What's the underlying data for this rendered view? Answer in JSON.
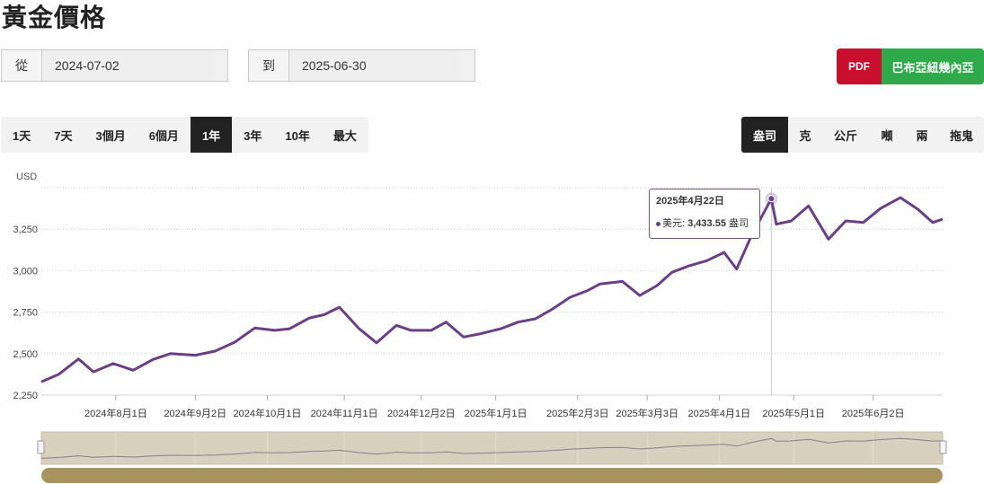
{
  "page": {
    "title": "黃金價格"
  },
  "date_range": {
    "from_label": "從",
    "from_value": "2024-07-02",
    "to_label": "到",
    "to_value": "2025-06-30"
  },
  "actions": {
    "pdf_label": "PDF",
    "region_label": "巴布亞紐幾內亞"
  },
  "periods": [
    "1天",
    "7天",
    "3個月",
    "6個月",
    "1年",
    "3年",
    "10年",
    "最大"
  ],
  "active_period": "1年",
  "units": [
    "盎司",
    "克",
    "公斤",
    "噸",
    "兩",
    "拖鬼"
  ],
  "active_unit": "盎司",
  "tooltip": {
    "date": "2025年4月22日",
    "series": "美元",
    "value": "3,433.55",
    "unit": "盎司"
  },
  "colors": {
    "line": "#6b3f86",
    "navigator_bg": "#d9cfbd",
    "navigator_bar": "#a8935e",
    "pdf": "#c8102e",
    "region": "#2eaa4a"
  },
  "chart_data": {
    "type": "line",
    "ylabel": "USD",
    "ylim": [
      2250,
      3500
    ],
    "yticks": [
      2250,
      2500,
      2750,
      3000,
      3250
    ],
    "ytick_labels": [
      "2,250",
      "2,500",
      "2,750",
      "3,000",
      "3,250"
    ],
    "x_range": [
      "2024-07-02",
      "2025-06-30"
    ],
    "xtick_dates": [
      "2024-08-01",
      "2024-09-02",
      "2024-10-01",
      "2024-11-01",
      "2024-12-02",
      "2025-01-01",
      "2025-02-03",
      "2025-03-03",
      "2025-04-01",
      "2025-05-01",
      "2025-06-02"
    ],
    "xtick_labels": [
      "2024年8月1日",
      "2024年9月2日",
      "2024年10月1日",
      "2024年11月1日",
      "2024年12月2日",
      "2025年1月1日",
      "2025年2月3日",
      "2025年3月3日",
      "2025年4月1日",
      "2025年5月1日",
      "2025年6月2日"
    ],
    "series": [
      {
        "x": [
          "2024-07-02",
          "2024-07-09",
          "2024-07-17",
          "2024-07-23",
          "2024-07-31",
          "2024-08-08",
          "2024-08-16",
          "2024-08-23",
          "2024-09-02",
          "2024-09-10",
          "2024-09-18",
          "2024-09-26",
          "2024-10-04",
          "2024-10-10",
          "2024-10-18",
          "2024-10-24",
          "2024-10-30",
          "2024-11-07",
          "2024-11-14",
          "2024-11-22",
          "2024-11-28",
          "2024-12-06",
          "2024-12-12",
          "2024-12-19",
          "2024-12-26",
          "2025-01-03",
          "2025-01-10",
          "2025-01-17",
          "2025-01-24",
          "2025-01-31",
          "2025-02-07",
          "2025-02-12",
          "2025-02-21",
          "2025-02-28",
          "2025-03-07",
          "2025-03-13",
          "2025-03-20",
          "2025-03-27",
          "2025-04-03",
          "2025-04-08",
          "2025-04-14",
          "2025-04-22",
          "2025-04-24",
          "2025-04-30",
          "2025-05-07",
          "2025-05-15",
          "2025-05-22",
          "2025-05-29",
          "2025-06-05",
          "2025-06-13",
          "2025-06-20",
          "2025-06-26",
          "2025-06-30"
        ],
        "y": [
          2330,
          2375,
          2468,
          2390,
          2440,
          2400,
          2465,
          2500,
          2490,
          2515,
          2570,
          2655,
          2640,
          2650,
          2715,
          2735,
          2780,
          2650,
          2565,
          2670,
          2640,
          2640,
          2690,
          2600,
          2620,
          2650,
          2690,
          2710,
          2770,
          2840,
          2880,
          2920,
          2935,
          2850,
          2910,
          2990,
          3030,
          3060,
          3110,
          3010,
          3210,
          3433.55,
          3280,
          3300,
          3390,
          3190,
          3300,
          3290,
          3375,
          3440,
          3370,
          3290,
          3310
        ]
      }
    ]
  }
}
